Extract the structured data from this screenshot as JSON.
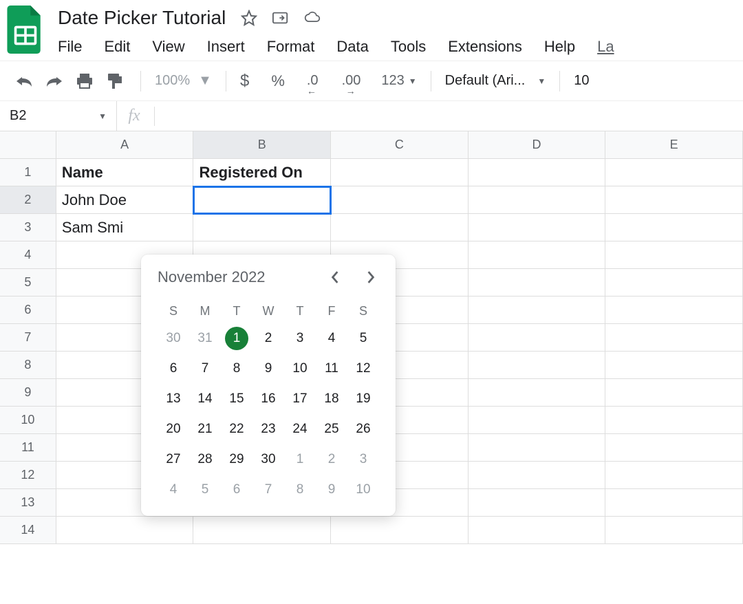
{
  "doc": {
    "title": "Date Picker Tutorial"
  },
  "menu": [
    "File",
    "Edit",
    "View",
    "Insert",
    "Format",
    "Data",
    "Tools",
    "Extensions",
    "Help",
    "La"
  ],
  "toolbar": {
    "zoom": "100%",
    "format_menu": "123",
    "font": "Default (Ari...",
    "font_size": "10"
  },
  "namebox": "B2",
  "columns": [
    "A",
    "B",
    "C",
    "D",
    "E"
  ],
  "rows": [
    "1",
    "2",
    "3",
    "4",
    "5",
    "6",
    "7",
    "8",
    "9",
    "10",
    "11",
    "12",
    "13",
    "14"
  ],
  "cells": {
    "A1": "Name",
    "B1": "Registered On",
    "A2": "John Doe",
    "A3": "Sam Smi"
  },
  "datepicker": {
    "month_label": "November 2022",
    "dow": [
      "S",
      "M",
      "T",
      "W",
      "T",
      "F",
      "S"
    ],
    "days": [
      {
        "n": "30",
        "muted": true
      },
      {
        "n": "31",
        "muted": true
      },
      {
        "n": "1",
        "selected": true
      },
      {
        "n": "2"
      },
      {
        "n": "3"
      },
      {
        "n": "4"
      },
      {
        "n": "5"
      },
      {
        "n": "6"
      },
      {
        "n": "7"
      },
      {
        "n": "8"
      },
      {
        "n": "9"
      },
      {
        "n": "10"
      },
      {
        "n": "11"
      },
      {
        "n": "12"
      },
      {
        "n": "13"
      },
      {
        "n": "14"
      },
      {
        "n": "15"
      },
      {
        "n": "16"
      },
      {
        "n": "17"
      },
      {
        "n": "18"
      },
      {
        "n": "19"
      },
      {
        "n": "20"
      },
      {
        "n": "21"
      },
      {
        "n": "22"
      },
      {
        "n": "23"
      },
      {
        "n": "24"
      },
      {
        "n": "25"
      },
      {
        "n": "26"
      },
      {
        "n": "27"
      },
      {
        "n": "28"
      },
      {
        "n": "29"
      },
      {
        "n": "30"
      },
      {
        "n": "1",
        "muted": true
      },
      {
        "n": "2",
        "muted": true
      },
      {
        "n": "3",
        "muted": true
      },
      {
        "n": "4",
        "muted": true
      },
      {
        "n": "5",
        "muted": true
      },
      {
        "n": "6",
        "muted": true
      },
      {
        "n": "7",
        "muted": true
      },
      {
        "n": "8",
        "muted": true
      },
      {
        "n": "9",
        "muted": true
      },
      {
        "n": "10",
        "muted": true
      }
    ]
  }
}
